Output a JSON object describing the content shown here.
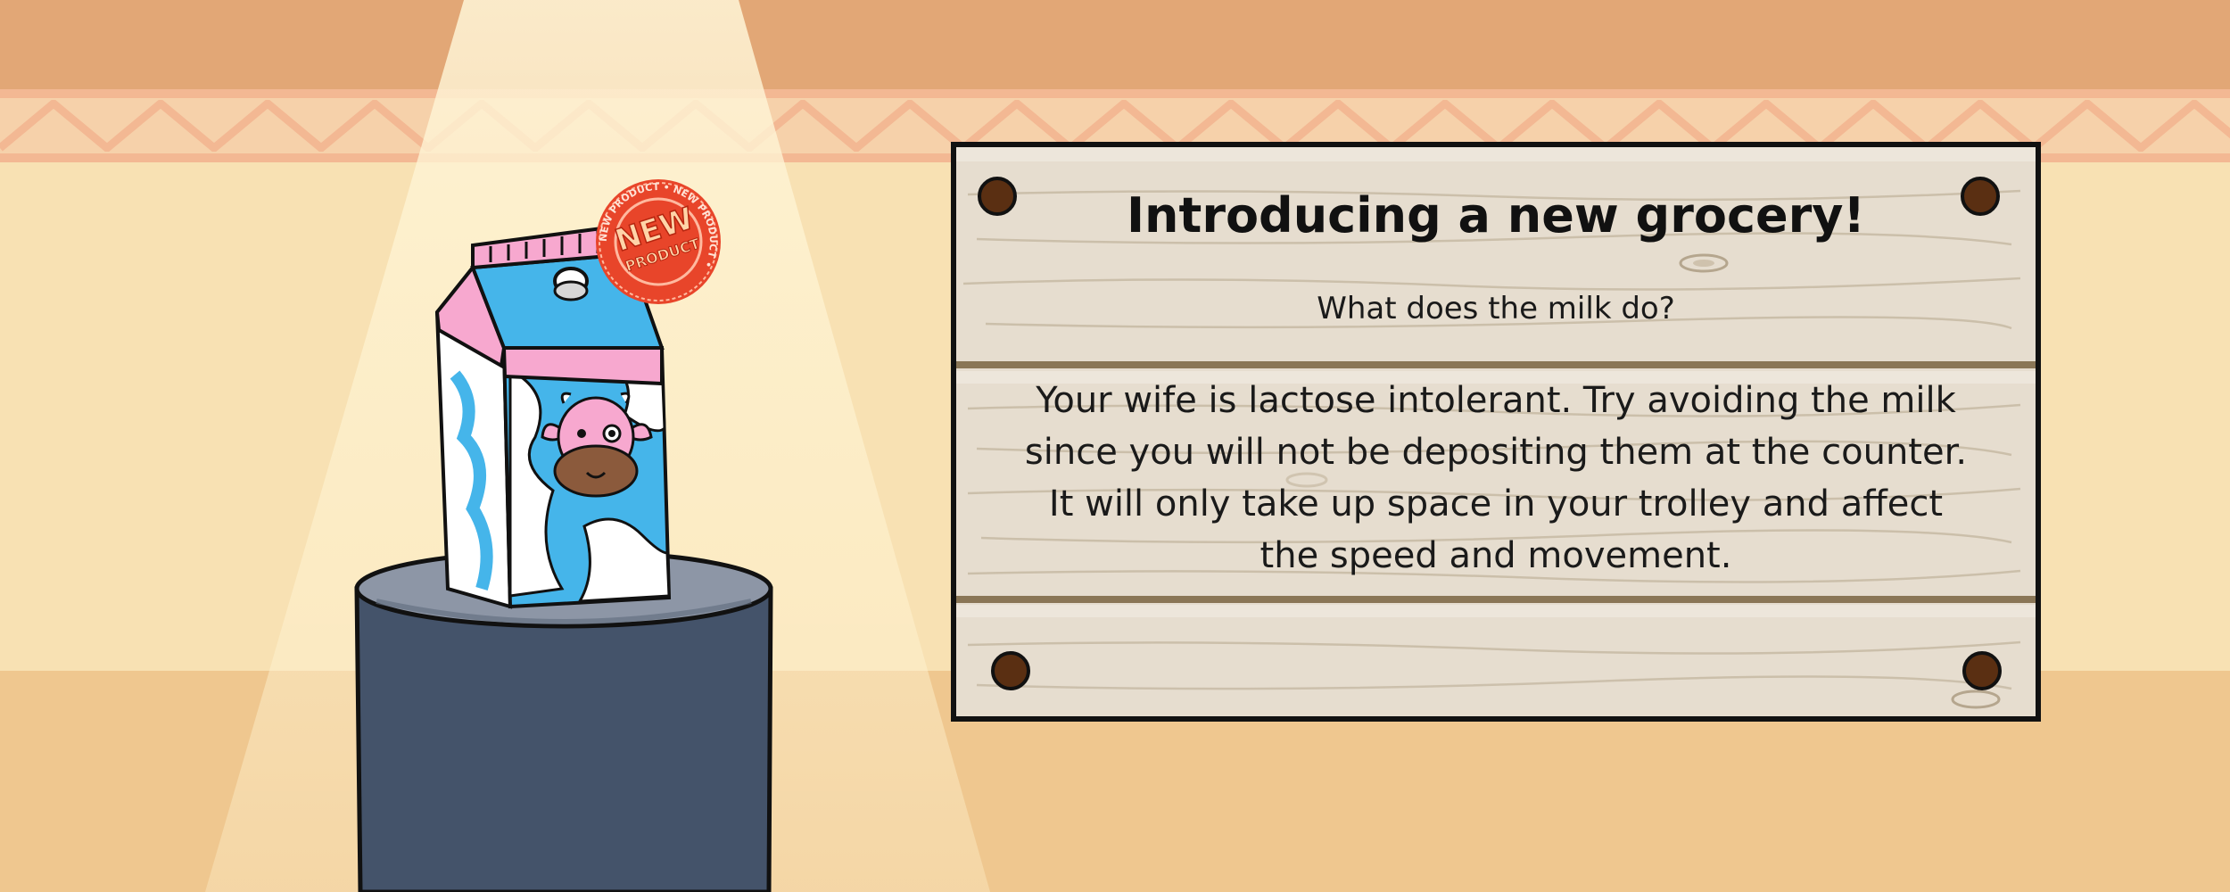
{
  "sign": {
    "title": "Introducing a new grocery!",
    "subtitle": "What does the milk do?",
    "description": "Your wife is lactose intolerant. Try avoiding the milk since you will not be depositing them at the counter. It will only take up space in your trolley and affect the speed and movement."
  },
  "product": {
    "name": "milk",
    "stamp_line1": "NEW",
    "stamp_line2": "PRODUCT",
    "stamp_ring": "NEW PRODUCT • NEW PRODUCT •"
  },
  "colors": {
    "top_band": "#e2a776",
    "wall": "#f8e1b3",
    "floor": "#efc78f",
    "wood": "#e6ddcf",
    "pedestal": "#44536a",
    "pedestal_top": "#8d96a6",
    "carton_blue": "#45b5ea",
    "carton_pink": "#f7a8cf",
    "stamp_red": "#e8452a"
  }
}
